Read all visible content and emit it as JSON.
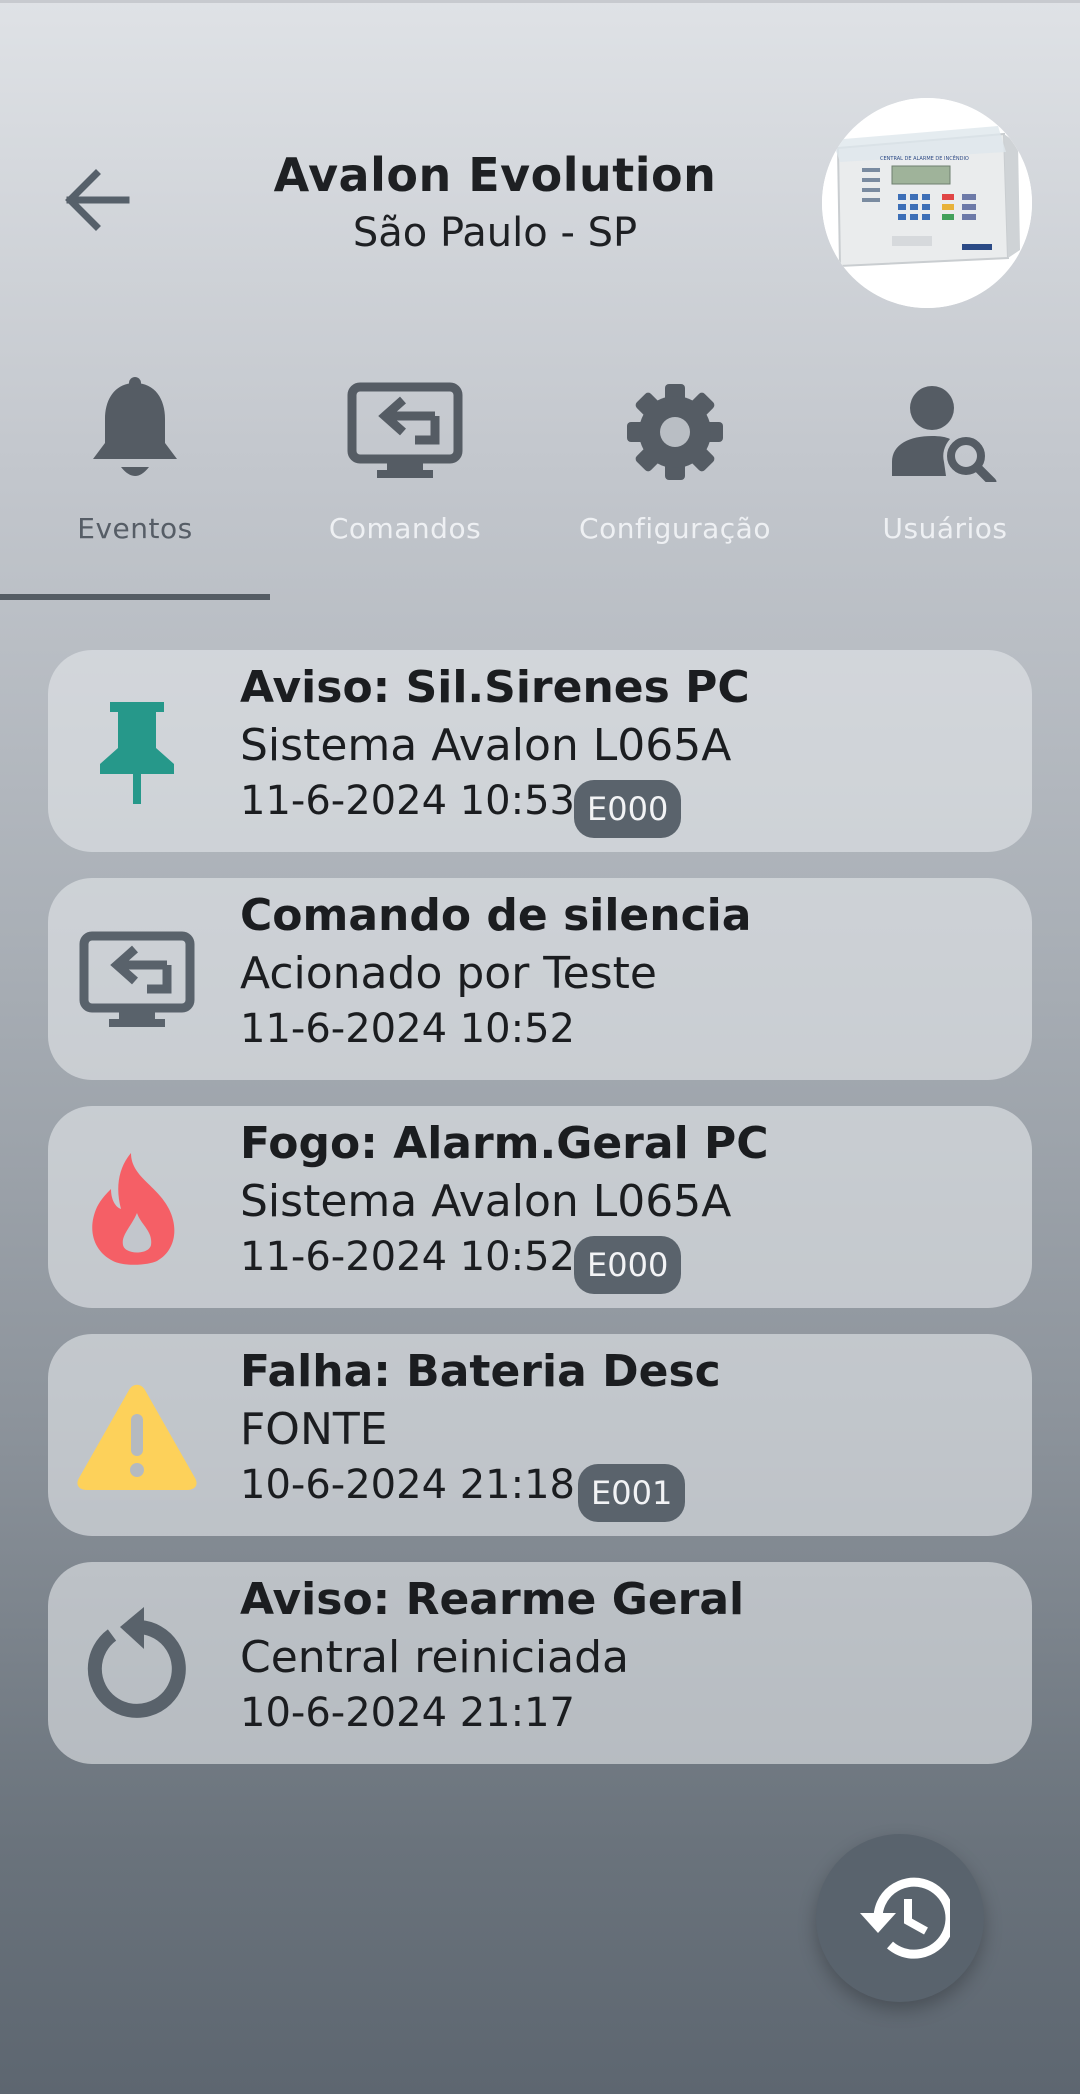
{
  "header": {
    "title": "Avalon Evolution",
    "subtitle": "São Paulo - SP",
    "back_icon": "arrow-left-icon",
    "device_image": "fire-alarm-panel-photo",
    "device_panel_text": "CENTRAL DE ALARME DE INCÊNDIO"
  },
  "tabs": [
    {
      "label": "Eventos",
      "icon": "bell-icon",
      "active": true
    },
    {
      "label": "Comandos",
      "icon": "monitor-arrow-icon",
      "active": false
    },
    {
      "label": "Configuração",
      "icon": "gear-icon",
      "active": false
    },
    {
      "label": "Usuários",
      "icon": "user-search-icon",
      "active": false
    }
  ],
  "events": [
    {
      "icon": "pin-icon",
      "icon_color": "#26988a",
      "title": "Aviso: Sil.Sirenes PC",
      "subtitle": "Sistema Avalon L065A",
      "datetime": "11-6-2024 10:53",
      "badge": "E000"
    },
    {
      "icon": "monitor-arrow-icon",
      "icon_color": "#59626b",
      "title": "Comando de silencia",
      "subtitle": "Acionado por Teste",
      "datetime": "11-6-2024 10:52",
      "badge": ""
    },
    {
      "icon": "fire-icon",
      "icon_color": "#f55f66",
      "title": "Fogo: Alarm.Geral PC",
      "subtitle": "Sistema Avalon L065A",
      "datetime": "11-6-2024 10:52",
      "badge": "E000"
    },
    {
      "icon": "warning-icon",
      "icon_color": "#fdd15a",
      "title": "Falha: Bateria Desc",
      "subtitle": "FONTE",
      "datetime": "10-6-2024 21:18",
      "badge": "E001"
    },
    {
      "icon": "reset-icon",
      "icon_color": "#59626b",
      "title": "Aviso: Rearme Geral",
      "subtitle": "Central reiniciada",
      "datetime": "10-6-2024 21:17",
      "badge": ""
    }
  ],
  "fab": {
    "icon": "history-icon"
  },
  "colors": {
    "accent_dark": "#555c64",
    "badge_bg": "#5a636c",
    "card_bg": "#e2e5e9",
    "pin": "#26988a",
    "fire": "#f55f66",
    "warning": "#fdd15a"
  }
}
